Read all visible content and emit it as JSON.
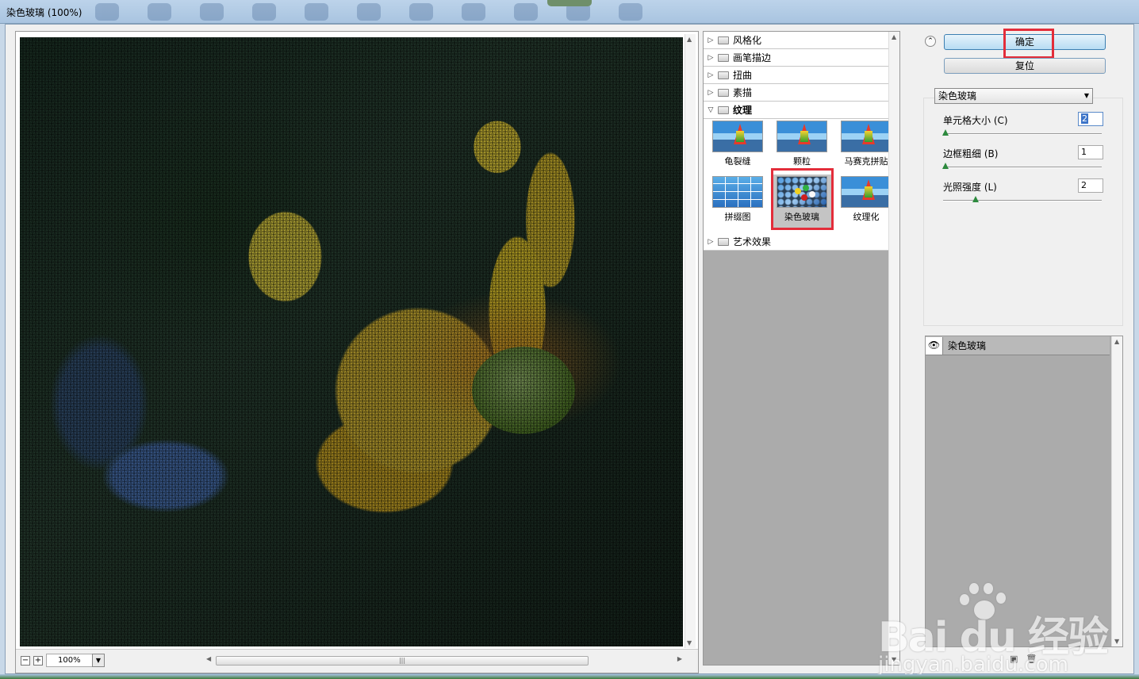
{
  "window": {
    "title": "染色玻璃 (100%)"
  },
  "preview": {
    "zoom_minus": "−",
    "zoom_plus": "+",
    "zoom_value": "100%"
  },
  "gallery": {
    "categories": [
      {
        "label": "风格化",
        "expanded": false
      },
      {
        "label": "画笔描边",
        "expanded": false
      },
      {
        "label": "扭曲",
        "expanded": false
      },
      {
        "label": "素描",
        "expanded": false
      },
      {
        "label": "纹理",
        "expanded": true
      },
      {
        "label": "艺术效果",
        "expanded": false
      }
    ],
    "texture_filters": [
      {
        "label": "龟裂缝",
        "selected": false
      },
      {
        "label": "颗粒",
        "selected": false
      },
      {
        "label": "马赛克拼贴",
        "selected": false
      },
      {
        "label": "拼缀图",
        "selected": false
      },
      {
        "label": "染色玻璃",
        "selected": true
      },
      {
        "label": "纹理化",
        "selected": false
      }
    ]
  },
  "buttons": {
    "ok": "确定",
    "reset": "复位"
  },
  "settings": {
    "filter_select": "染色玻璃",
    "params": [
      {
        "label": "单元格大小 (C)",
        "value": "2",
        "fraction": 0.0
      },
      {
        "label": "边框粗细 (B)",
        "value": "1",
        "fraction": 0.0
      },
      {
        "label": "光照强度 (L)",
        "value": "2",
        "fraction": 0.2
      }
    ]
  },
  "layers": {
    "items": [
      {
        "label": "染色玻璃",
        "visible": true
      }
    ]
  },
  "watermark": {
    "brand": "Bai du 经验",
    "url": "jingyan.baidu.com"
  },
  "colors": {
    "highlight_red": "#e32d3a",
    "slider_knob": "#2d8a3e",
    "ok_button": "#b7dcf3"
  }
}
